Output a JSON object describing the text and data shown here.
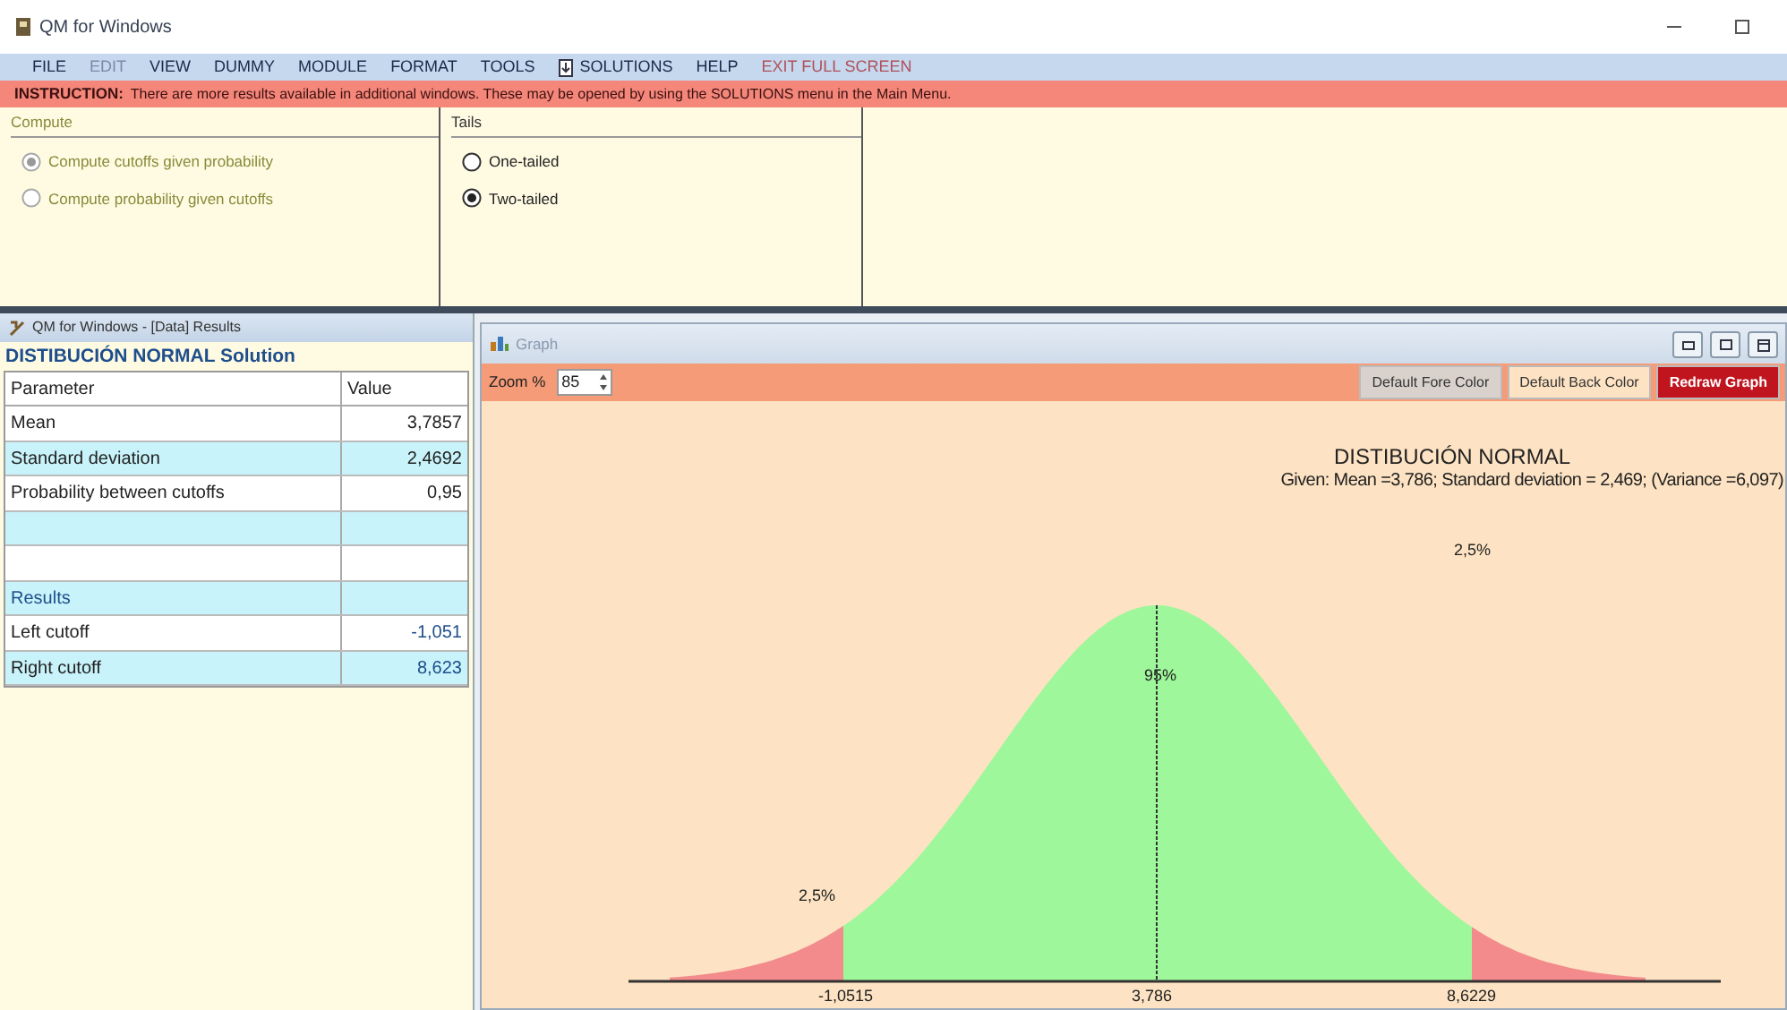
{
  "window": {
    "title": "QM for Windows"
  },
  "menu": [
    {
      "label": "FILE",
      "kind": "plain"
    },
    {
      "label": "EDIT",
      "kind": "disabled"
    },
    {
      "label": "VIEW",
      "kind": "plain"
    },
    {
      "label": "DUMMY",
      "kind": "plain"
    },
    {
      "label": "MODULE",
      "kind": "plain"
    },
    {
      "label": "FORMAT",
      "kind": "plain"
    },
    {
      "label": "TOOLS",
      "kind": "plain"
    },
    {
      "label": "SOLUTIONS",
      "kind": "icon"
    },
    {
      "label": "HELP",
      "kind": "plain"
    },
    {
      "label": "EXIT FULL SCREEN",
      "kind": "exit"
    }
  ],
  "instruction": {
    "label": "INSTRUCTION:",
    "text": "There are more results available in additional windows. These may be opened by using the SOLUTIONS menu in the Main Menu."
  },
  "compute": {
    "title": "Compute",
    "disabled": true,
    "options": [
      {
        "label": "Compute cutoffs given probability",
        "selected": true
      },
      {
        "label": "Compute probability given cutoffs",
        "selected": false
      }
    ]
  },
  "tails": {
    "title": "Tails",
    "options": [
      {
        "label": "One-tailed",
        "selected": false
      },
      {
        "label": "Two-tailed",
        "selected": true
      }
    ]
  },
  "results": {
    "title": "QM for Windows - [Data] Results",
    "heading": "DISTIBUCIÓN NORMAL Solution",
    "columns": [
      "Parameter",
      "Value"
    ],
    "rows": [
      {
        "kind": "data",
        "cells": [
          "Mean",
          "3,7857"
        ]
      },
      {
        "kind": "data",
        "cells": [
          "Standard deviation",
          "2,4692"
        ]
      },
      {
        "kind": "data",
        "cells": [
          "Probability between cutoffs",
          "0,95"
        ]
      },
      {
        "kind": "blank",
        "cells": []
      },
      {
        "kind": "blank",
        "cells": []
      },
      {
        "kind": "section",
        "cells": [
          "Results"
        ]
      },
      {
        "kind": "data",
        "cells": [
          "Left cutoff",
          "-1,051"
        ]
      },
      {
        "kind": "data",
        "cells": [
          "Right cutoff",
          "8,623"
        ]
      }
    ]
  },
  "graph": {
    "title": "Graph",
    "zoom_label": "Zoom %",
    "zoom_value": "85",
    "buttons": [
      {
        "label": "Default Fore Color",
        "kind": "fore"
      },
      {
        "label": "Default Back Color",
        "kind": "back"
      },
      {
        "label": "Redraw Graph",
        "kind": "redraw"
      }
    ],
    "chart_title": "DISTIBUCIÓN NORMAL",
    "subtitle": "Given: Mean =3,786; Standard deviation = 2,469; (Variance =6,097)",
    "right_tail_label": "2,5%",
    "center_label": "95%",
    "left_tail_label": "2,5%",
    "axis_labels": [
      "-1,0515",
      "3,786",
      "8,6229"
    ]
  }
}
